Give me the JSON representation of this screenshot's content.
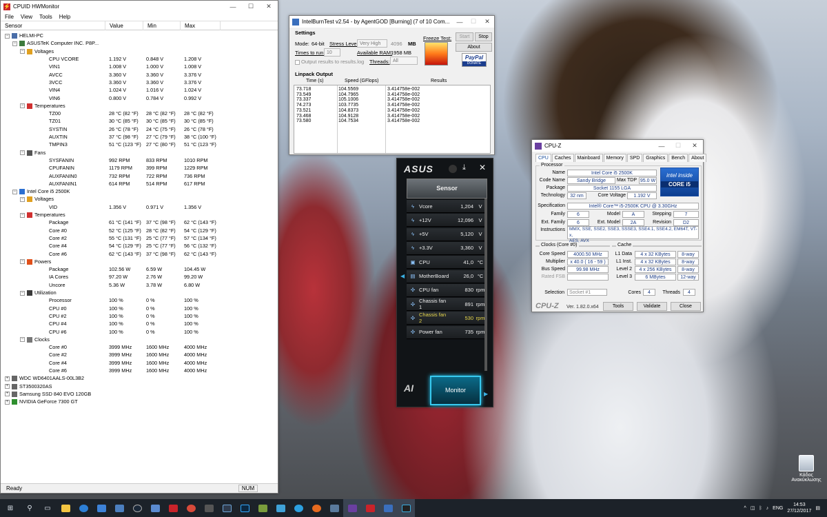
{
  "hwmonitor": {
    "title": "CPUID HWMonitor",
    "menu": [
      "File",
      "View",
      "Tools",
      "Help"
    ],
    "columns": [
      "Sensor",
      "Value",
      "Min",
      "Max"
    ],
    "rows": [
      {
        "lvl": 0,
        "type": "exp",
        "name": "HELMI-PC",
        "icon": "computer-icon"
      },
      {
        "lvl": 1,
        "type": "exp",
        "name": "ASUSTeK Computer INC. P8P...",
        "icon": "motherboard-icon"
      },
      {
        "lvl": 2,
        "type": "exp",
        "name": "Voltages",
        "icon": "voltage-icon"
      },
      {
        "lvl": 3,
        "name": "CPU VCORE",
        "value": "1.192 V",
        "min": "0.848 V",
        "max": "1.208 V"
      },
      {
        "lvl": 3,
        "name": "VIN1",
        "value": "1.008 V",
        "min": "1.000 V",
        "max": "1.008 V"
      },
      {
        "lvl": 3,
        "name": "AVCC",
        "value": "3.360 V",
        "min": "3.360 V",
        "max": "3.376 V"
      },
      {
        "lvl": 3,
        "name": "3VCC",
        "value": "3.360 V",
        "min": "3.360 V",
        "max": "3.376 V"
      },
      {
        "lvl": 3,
        "name": "VIN4",
        "value": "1.024 V",
        "min": "1.016 V",
        "max": "1.024 V"
      },
      {
        "lvl": 3,
        "name": "VIN6",
        "value": "0.800 V",
        "min": "0.784 V",
        "max": "0.992 V"
      },
      {
        "lvl": 2,
        "type": "exp",
        "name": "Temperatures",
        "icon": "thermometer-icon"
      },
      {
        "lvl": 3,
        "name": "TZ00",
        "value": "28 °C  (82 °F)",
        "min": "28 °C  (82 °F)",
        "max": "28 °C  (82 °F)"
      },
      {
        "lvl": 3,
        "name": "TZ01",
        "value": "30 °C  (85 °F)",
        "min": "30 °C  (85 °F)",
        "max": "30 °C  (85 °F)"
      },
      {
        "lvl": 3,
        "name": "SYSTIN",
        "value": "26 °C  (78 °F)",
        "min": "24 °C  (75 °F)",
        "max": "26 °C  (78 °F)"
      },
      {
        "lvl": 3,
        "name": "AUXTIN",
        "value": "37 °C  (98 °F)",
        "min": "27 °C  (79 °F)",
        "max": "38 °C  (100 °F)"
      },
      {
        "lvl": 3,
        "name": "TMPIN3",
        "value": "51 °C  (123 °F)",
        "min": "27 °C  (80 °F)",
        "max": "51 °C  (123 °F)"
      },
      {
        "lvl": 2,
        "type": "exp",
        "name": "Fans",
        "icon": "fan-icon"
      },
      {
        "lvl": 3,
        "name": "SYSFANIN",
        "value": "992 RPM",
        "min": "833 RPM",
        "max": "1010 RPM"
      },
      {
        "lvl": 3,
        "name": "CPUFANIN",
        "value": "1179 RPM",
        "min": "399 RPM",
        "max": "1229 RPM"
      },
      {
        "lvl": 3,
        "name": "AUXFANIN0",
        "value": "732 RPM",
        "min": "722 RPM",
        "max": "736 RPM"
      },
      {
        "lvl": 3,
        "name": "AUXFANIN1",
        "value": "614 RPM",
        "min": "514 RPM",
        "max": "617 RPM"
      },
      {
        "lvl": 1,
        "type": "exp",
        "name": "Intel Core i5 2500K",
        "icon": "cpu-icon"
      },
      {
        "lvl": 2,
        "type": "exp",
        "name": "Voltages",
        "icon": "voltage-icon"
      },
      {
        "lvl": 3,
        "name": "VID",
        "value": "1.356 V",
        "min": "0.971 V",
        "max": "1.356 V"
      },
      {
        "lvl": 2,
        "type": "exp",
        "name": "Temperatures",
        "icon": "thermometer-icon"
      },
      {
        "lvl": 3,
        "name": "Package",
        "value": "61 °C  (141 °F)",
        "min": "37 °C  (98 °F)",
        "max": "62 °C  (143 °F)"
      },
      {
        "lvl": 3,
        "name": "Core #0",
        "value": "52 °C  (125 °F)",
        "min": "28 °C  (82 °F)",
        "max": "54 °C  (129 °F)"
      },
      {
        "lvl": 3,
        "name": "Core #2",
        "value": "55 °C  (131 °F)",
        "min": "25 °C  (77 °F)",
        "max": "57 °C  (134 °F)"
      },
      {
        "lvl": 3,
        "name": "Core #4",
        "value": "54 °C  (129 °F)",
        "min": "25 °C  (77 °F)",
        "max": "56 °C  (132 °F)"
      },
      {
        "lvl": 3,
        "name": "Core #6",
        "value": "62 °C  (143 °F)",
        "min": "37 °C  (98 °F)",
        "max": "62 °C  (143 °F)"
      },
      {
        "lvl": 2,
        "type": "exp",
        "name": "Powers",
        "icon": "power-icon"
      },
      {
        "lvl": 3,
        "name": "Package",
        "value": "102.56 W",
        "min": "6.59 W",
        "max": "104.45 W"
      },
      {
        "lvl": 3,
        "name": "IA Cores",
        "value": "97.20 W",
        "min": "2.76 W",
        "max": "99.20 W"
      },
      {
        "lvl": 3,
        "name": "Uncore",
        "value": "5.36 W",
        "min": "3.78 W",
        "max": "6.80 W"
      },
      {
        "lvl": 2,
        "type": "exp",
        "name": "Utilization",
        "icon": "utilization-icon"
      },
      {
        "lvl": 3,
        "name": "Processor",
        "value": "100 %",
        "min": "0 %",
        "max": "100 %"
      },
      {
        "lvl": 3,
        "name": "CPU #0",
        "value": "100 %",
        "min": "0 %",
        "max": "100 %"
      },
      {
        "lvl": 3,
        "name": "CPU #2",
        "value": "100 %",
        "min": "0 %",
        "max": "100 %"
      },
      {
        "lvl": 3,
        "name": "CPU #4",
        "value": "100 %",
        "min": "0 %",
        "max": "100 %"
      },
      {
        "lvl": 3,
        "name": "CPU #6",
        "value": "100 %",
        "min": "0 %",
        "max": "100 %"
      },
      {
        "lvl": 2,
        "type": "exp",
        "name": "Clocks",
        "icon": "clock-icon"
      },
      {
        "lvl": 3,
        "name": "Core #0",
        "value": "3999 MHz",
        "min": "1600 MHz",
        "max": "4000 MHz"
      },
      {
        "lvl": 3,
        "name": "Core #2",
        "value": "3999 MHz",
        "min": "1600 MHz",
        "max": "4000 MHz"
      },
      {
        "lvl": 3,
        "name": "Core #4",
        "value": "3999 MHz",
        "min": "1600 MHz",
        "max": "4000 MHz"
      },
      {
        "lvl": 3,
        "name": "Core #6",
        "value": "3999 MHz",
        "min": "1600 MHz",
        "max": "4000 MHz"
      },
      {
        "lvl": 0,
        "type": "col",
        "name": "WDC WD6401AALS-00L3B2",
        "icon": "drive-icon"
      },
      {
        "lvl": 0,
        "type": "col",
        "name": "ST3500320AS",
        "icon": "drive-icon"
      },
      {
        "lvl": 0,
        "type": "col",
        "name": "Samsung SSD 840 EVO 120GB",
        "icon": "drive-icon"
      },
      {
        "lvl": 0,
        "type": "col",
        "name": "NVIDIA GeForce 7300 GT",
        "icon": "gpu-icon"
      }
    ],
    "status": "Ready",
    "num": "NUM"
  },
  "ibt": {
    "title": "IntelBurnTest v2.54 - by AgentGOD [Burning] (7 of 10 Com...",
    "settings": "Settings",
    "mode_label": "Mode:",
    "mode_value": "64-bit",
    "stress_label": "Stress Level:",
    "stress_value": "Very High",
    "mem_value": "4096",
    "mem_unit": "MB",
    "times_label": "Times to run:",
    "times_value": "10",
    "ram_label": "Available RAM:",
    "ram_value": "1958 MB",
    "threads_label": "Threads:",
    "threads_value": "All",
    "output_label": "Output results to results.log",
    "freeze_label": "Freeze Test:",
    "start": "Start",
    "stop": "Stop",
    "about": "About",
    "paypal": "PayPal",
    "donate": "DONATE",
    "linpack": "Linpack Output",
    "col_time": "Time (s)",
    "col_speed": "Speed (GFlops)",
    "col_results": "Results",
    "times": [
      "73.718",
      "73.549",
      "73.337",
      "74.273",
      "73.521",
      "73.468",
      "73.580"
    ],
    "speeds": [
      "104.5569",
      "104.7965",
      "105.1006",
      "103.7735",
      "104.8373",
      "104.9128",
      "104.7534"
    ],
    "results": [
      "3.414758e-002",
      "3.414758e-002",
      "3.414758e-002",
      "3.414758e-002",
      "3.414758e-002",
      "3.414758e-002",
      "3.414758e-002"
    ]
  },
  "asus": {
    "logo": "ASUS",
    "header": "Sensor",
    "sensors": [
      {
        "icon": "voltage-icon",
        "label": "Vcore",
        "value": "1,204",
        "unit": "V"
      },
      {
        "icon": "voltage-icon",
        "label": "+12V",
        "value": "12,096",
        "unit": "V"
      },
      {
        "icon": "voltage-icon",
        "label": "+5V",
        "value": "5,120",
        "unit": "V"
      },
      {
        "icon": "voltage-icon",
        "label": "+3.3V",
        "value": "3,360",
        "unit": "V"
      },
      {
        "icon": "cpu-icon",
        "label": "CPU",
        "value": "41,0",
        "unit": "°C"
      },
      {
        "icon": "motherboard-icon",
        "label": "MotherBoard",
        "value": "26,0",
        "unit": "°C"
      },
      {
        "icon": "fan-icon",
        "label": "CPU fan",
        "value": "830",
        "unit": "rpm"
      },
      {
        "icon": "fan-icon",
        "label": "Chassis fan 1",
        "value": "891",
        "unit": "rpm"
      },
      {
        "icon": "fan-icon",
        "label": "Chassis fan 2",
        "value": "530",
        "unit": "rpm",
        "highlight": "#e8d84c"
      },
      {
        "icon": "fan-icon",
        "label": "Power fan",
        "value": "735",
        "unit": "rpm"
      }
    ],
    "monitor": "Monitor"
  },
  "cpuz": {
    "title": "CPU-Z",
    "tabs": [
      "CPU",
      "Caches",
      "Mainboard",
      "Memory",
      "SPD",
      "Graphics",
      "Bench",
      "About"
    ],
    "processor": "Processor",
    "name_l": "Name",
    "name": "Intel Core i5 2500K",
    "codename_l": "Code Name",
    "codename": "Sandy Bridge",
    "tdp_l": "Max TDP",
    "tdp": "95.0 W",
    "package_l": "Package",
    "package": "Socket 1155 LGA",
    "tech_l": "Technology",
    "tech": "32 nm",
    "cv_l": "Core Voltage",
    "cv": "1.192 V",
    "spec_l": "Specification",
    "spec": "Intel® Core™ i5-2500K CPU @ 3.30GHz",
    "family_l": "Family",
    "family": "6",
    "model_l": "Model",
    "model": "A",
    "stepping_l": "Stepping",
    "stepping": "7",
    "extfam_l": "Ext. Family",
    "extfam": "6",
    "extmodel_l": "Ext. Model",
    "extmodel": "2A",
    "rev_l": "Revision",
    "rev": "D2",
    "instr_l": "Instructions",
    "instr1": "MMX, SSE, SSE2, SSE3, SSSE3, SSE4.1, SSE4.2, EM64T, VT-x,",
    "instr2": "AES, AVX",
    "clocks": "Clocks (Core #0)",
    "cache": "Cache",
    "cs_l": "Core Speed",
    "cs": "4000.50 MHz",
    "mul_l": "Multiplier",
    "mul": "x 40.0  ( 16 - 59 )",
    "bus_l": "Bus Speed",
    "bus": "99.98 MHz",
    "fsb_l": "Rated FSB",
    "l1d_l": "L1 Data",
    "l1d": "4 x 32 KBytes",
    "l1d_w": "8-way",
    "l1i_l": "L1 Inst.",
    "l1i": "4 x 32 KBytes",
    "l1i_w": "8-way",
    "l2_l": "Level 2",
    "l2": "4 x 256 KBytes",
    "l2_w": "8-way",
    "l3_l": "Level 3",
    "l3": "6 MBytes",
    "l3_w": "12-way",
    "sel_l": "Selection",
    "sel": "Socket #1",
    "cores_l": "Cores",
    "cores": "4",
    "threads_l": "Threads",
    "threads": "4",
    "logo": "CPU-Z",
    "ver": "Ver. 1.82.0.x64",
    "tools": "Tools",
    "validate": "Validate",
    "close": "Close",
    "intel_inside": "intel inside",
    "intel_core": "CORE i5"
  },
  "desktop": {
    "recycle": "Κάδος Ανακύκλωσης"
  },
  "taskbar": {
    "lang": "ENG",
    "time": "14:53",
    "date": "27/12/2017"
  }
}
